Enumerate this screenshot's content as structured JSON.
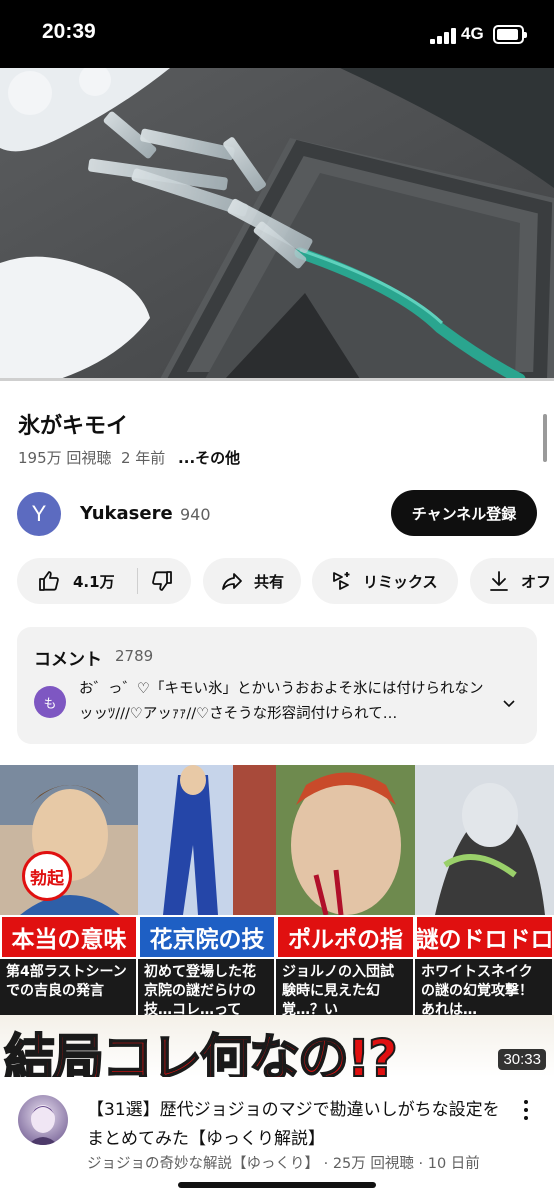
{
  "status_bar": {
    "time": "20:39",
    "network": "4G"
  },
  "video": {
    "title": "氷がキモイ",
    "views": "195万 回視聴",
    "age": "2 年前",
    "more_label": "...その他"
  },
  "channel": {
    "avatar_letter": "Y",
    "name": "Yukasere",
    "subscribers": "940",
    "subscribe_label": "チャンネル登録"
  },
  "actions": {
    "like_count": "4.1万",
    "share_label": "共有",
    "remix_label": "リミックス",
    "offline_label": "オフ"
  },
  "comments": {
    "header": "コメント",
    "count": "2789",
    "avatar_letter": "も",
    "top_comment": "お゛っ゛♡「キモい氷」とかいうおおよそ氷には付けられなンッッﾂ///♡アッｧｧ//♡さそうな形容詞付けられて…"
  },
  "recommended": {
    "thumb_badge": "勃起",
    "panels": [
      {
        "label": "本当の意味",
        "sub": "第4部ラストシーンでの吉良の発言"
      },
      {
        "label": "花京院の技",
        "sub": "初めて登場した花京院の謎だらけの技…コレ…って"
      },
      {
        "label": "ポルポの指",
        "sub": "ジョルノの入団試験時に見えた幻覚…？い"
      },
      {
        "label": "謎のドロドロ",
        "sub": "ホワイトスネイクの謎の幻覚攻撃！あれは…"
      }
    ],
    "headline": "結局コレ何なの!?",
    "duration": "30:33",
    "title": "【31選】歴代ジョジョのマジで勘違いしがちな設定をまとめてみた【ゆっくり解説】",
    "meta": "ジョジョの奇妙な解説【ゆっくり】 · 25万 回視聴 · 10 日前"
  }
}
